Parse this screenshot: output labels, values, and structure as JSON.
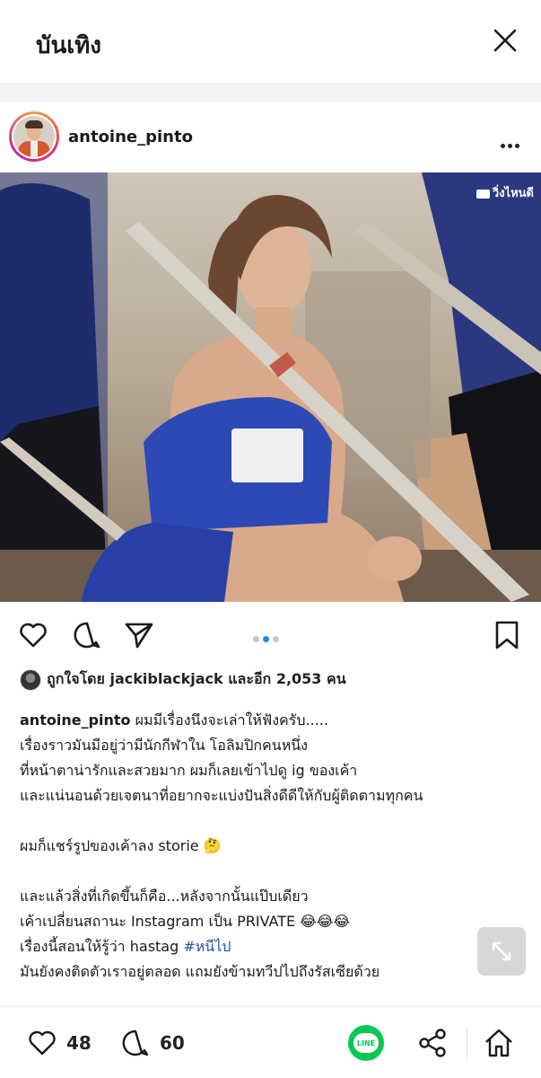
{
  "header": {
    "title": "บันเทิง",
    "close_icon": "close-icon"
  },
  "post": {
    "username": "antoine_pinto",
    "more_icon": "more-horizontal-icon",
    "watermark": "วิ่งไหนดี",
    "carousel": {
      "total": 3,
      "active": 2
    }
  },
  "likes": {
    "prefix": "ถูกใจโดย",
    "user": "jackiblackjack",
    "conjunction": "และอีก",
    "count": "2,053",
    "suffix": "คน"
  },
  "caption": {
    "username": "antoine_pinto",
    "line1": " ผมมีเรื่องนึงจะเล่าให้ฟังครับ.....",
    "line2": "เรื่องราวมันมีอยู่ว่ามีนักกีฬาใน โอลิมปิกคนหนึ่ง",
    "line3": "ที่หน้าตาน่ารักและสวยมาก ผมก็เลยเข้าไปดู ig ของเค้า",
    "line4": "และแน่นอนด้วยเจตนาที่อยากจะแบ่งปันสิ่งดีดีให้กับผู้ติดตามทุกคน",
    "line5": "ผมก็แชร์รูปของเค้าลง storie 🤔",
    "line6": "และแล้วสิ่งที่เกิดขึ้นก็คือ...หลังจากนั้นแป๊บเดียว",
    "line7": "เค้าเปลี่ยนสถานะ Instagram เป็น PRIVATE 😂😂😂",
    "line8_text": "เรื่องนี้สอนให้รู้ว่า  hastag ",
    "line8_tag": "#หนีไป",
    "line9": "มันยังคงติดตัวเราอยู่ตลอด แถมยังข้ามทวีปไปถึงรัสเซียด้วย"
  },
  "bottom_bar": {
    "likes": "48",
    "comments": "60",
    "line_label": "LINE"
  },
  "colors": {
    "accent": "#1b8cf2",
    "hashtag": "#1a5aa8",
    "line_green": "#06c755"
  }
}
